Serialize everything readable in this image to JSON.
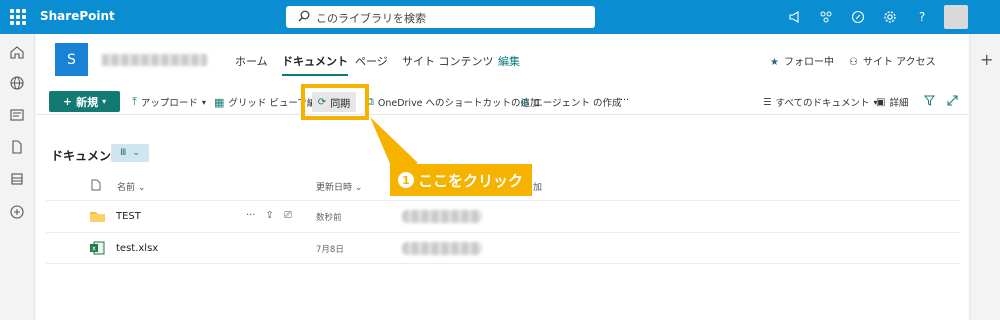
{
  "suite": {
    "brand": "SharePoint",
    "search_placeholder": "このライブラリを検索",
    "help_label": "?"
  },
  "site": {
    "logo_letter": "S",
    "nav": [
      {
        "label": "ホーム"
      },
      {
        "label": "ドキュメント",
        "active": true
      },
      {
        "label": "ページ"
      },
      {
        "label": "サイト コンテンツ"
      },
      {
        "label": "編集"
      }
    ],
    "follow_label": "フォロー中",
    "access_label": "サイト アクセス"
  },
  "commandbar": {
    "new_label": "新規",
    "upload_label": "アップロード",
    "grid_edit_label": "グリッド ビューで編集",
    "sync_label": "同期",
    "onedrive_label": "OneDrive へのショートカットの追加",
    "agent_label": "エージェント の作成",
    "more_label": "···",
    "view_label": "すべてのドキュメント",
    "details_label": "詳細"
  },
  "library": {
    "title": "ドキュメント",
    "columns": {
      "name": "名前",
      "modified": "更新日時",
      "modified_by_suffix": "加"
    },
    "rows": [
      {
        "name": "TEST",
        "type": "folder",
        "modified": "数秒前"
      },
      {
        "name": "test.xlsx",
        "type": "excel",
        "modified": "7月8日"
      }
    ]
  },
  "annotation": {
    "number": "1",
    "text": "ここをクリック",
    "color": "#f5b300"
  },
  "colors": {
    "suitebar": "#0a8ed1",
    "accent": "#127a72",
    "site_logo": "#1a82d4"
  }
}
